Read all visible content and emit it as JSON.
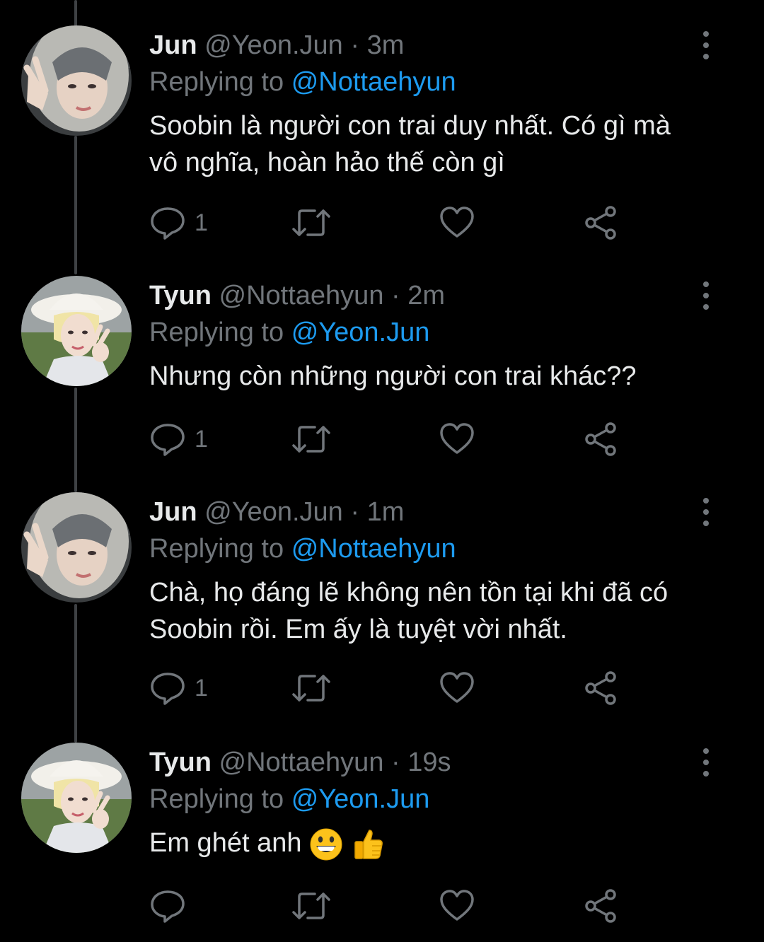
{
  "tweets": [
    {
      "name": "Jun",
      "handle": "@Yeon.Jun",
      "separator": "·",
      "time": "3m",
      "replying_prefix": "Replying to",
      "replying_to": "@Nottaehyun",
      "text": "Soobin là người con trai duy nhất. Có gì mà vô nghĩa, hoàn hảo thế còn gì",
      "reply_count": "1",
      "avatar": "jun-avatar"
    },
    {
      "name": "Tyun",
      "handle": "@Nottaehyun",
      "separator": "·",
      "time": "2m",
      "replying_prefix": "Replying to",
      "replying_to": "@Yeon.Jun",
      "text": "Nhưng còn những người con trai khác??",
      "reply_count": "1",
      "avatar": "tyun-avatar"
    },
    {
      "name": "Jun",
      "handle": "@Yeon.Jun",
      "separator": "·",
      "time": "1m",
      "replying_prefix": "Replying to",
      "replying_to": "@Nottaehyun",
      "text": "Chà, họ đáng lẽ không nên tồn tại khi đã có Soobin rồi. Em ấy là tuyệt vời nhất.",
      "reply_count": "1",
      "avatar": "jun-avatar"
    },
    {
      "name": "Tyun",
      "handle": "@Nottaehyun",
      "separator": "·",
      "time": "19s",
      "replying_prefix": "Replying to",
      "replying_to": "@Yeon.Jun",
      "text": "Em ghét anh",
      "text_emoji": [
        "grinning-face",
        "thumbs-up"
      ],
      "reply_count": "",
      "avatar": "tyun-avatar"
    }
  ],
  "colors": {
    "background": "#000000",
    "primary_text": "#e7e9ea",
    "secondary_text": "#71767b",
    "mention": "#1d9bf0",
    "thread_line": "#3e4144"
  },
  "icons": {
    "reply": "reply-icon",
    "retweet": "retweet-icon",
    "like": "heart-icon",
    "share": "share-icon",
    "more": "more-vertical-icon"
  }
}
